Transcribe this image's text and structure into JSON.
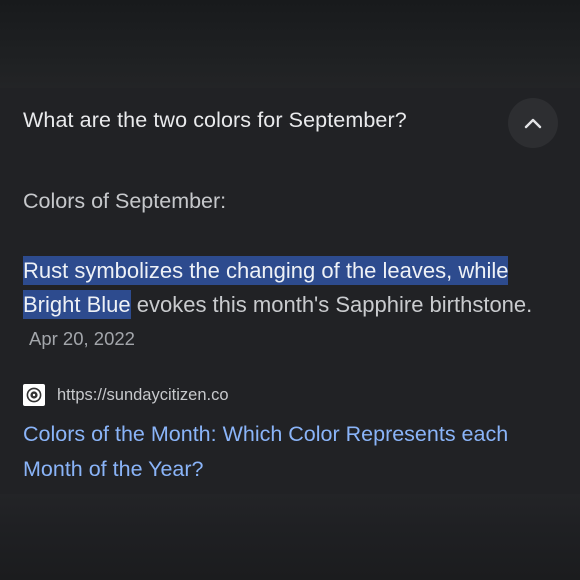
{
  "question": "What are the two colors for September?",
  "heading": "Colors of September:",
  "answer": {
    "highlighted_1": "Rust symbolizes the changing of the leaves, while",
    "highlighted_2": "Bright Blue",
    "rest": " evokes this month's Sapphire birthstone.",
    "date": "Apr 20, 2022"
  },
  "source": {
    "url": "https://sundaycitizen.co",
    "icon": "site-favicon-icon"
  },
  "result_link": "Colors of the Month: Which Color Represents each Month of the Year?",
  "colors": {
    "link": "#8ab4f8",
    "highlight": "#2d4b8e",
    "card_bg": "#212225"
  }
}
